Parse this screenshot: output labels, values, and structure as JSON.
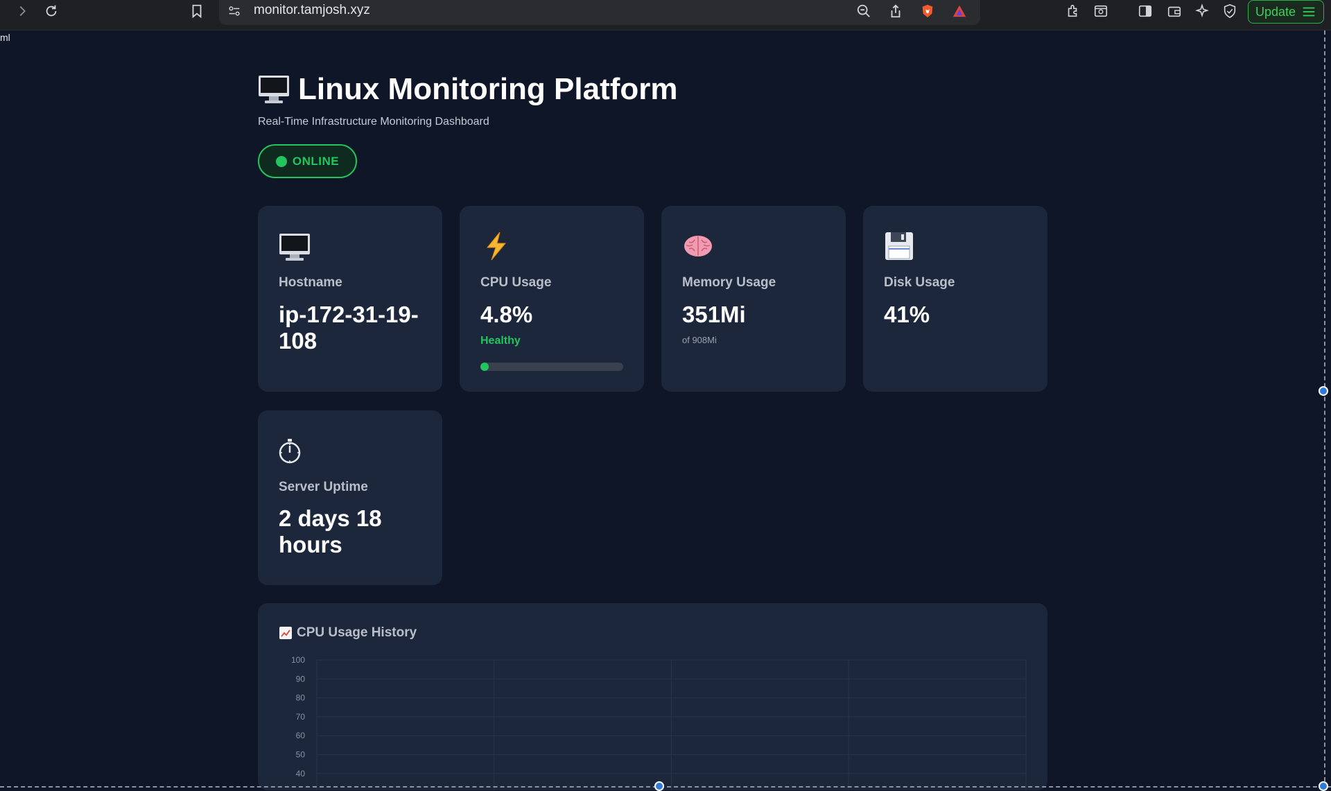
{
  "browser": {
    "url": "monitor.tamjosh.xyz",
    "update_label": "Update",
    "side_text": "ml"
  },
  "header": {
    "title": "Linux Monitoring Platform",
    "subtitle": "Real-Time Infrastructure Monitoring Dashboard",
    "status": "ONLINE"
  },
  "cards": {
    "hostname": {
      "label": "Hostname",
      "value": "ip-172-31-19-108",
      "icon": "computer-icon"
    },
    "cpu": {
      "label": "CPU Usage",
      "value": "4.8%",
      "status": "Healthy",
      "progress": 0.048,
      "icon": "lightning-icon"
    },
    "memory": {
      "label": "Memory Usage",
      "value": "351Mi",
      "sub": "of 908Mi",
      "icon": "brain-icon"
    },
    "disk": {
      "label": "Disk Usage",
      "value": "41%",
      "icon": "floppy-disk-icon"
    },
    "uptime": {
      "label": "Server Uptime",
      "value": "2 days 18 hours",
      "icon": "stopwatch-icon"
    }
  },
  "colors": {
    "background": "#0e1628",
    "card": "#1d273b",
    "accent_green": "#22c55e"
  },
  "chart": {
    "title": "CPU Usage History",
    "icon": "chart-increasing-icon"
  },
  "chart_data": {
    "type": "line",
    "title": "CPU Usage History",
    "xlabel": "",
    "ylabel": "",
    "ylim": [
      0,
      100
    ],
    "yticks_visible": [
      100,
      90,
      80,
      70,
      60,
      50,
      40
    ],
    "grid": true,
    "series": []
  }
}
